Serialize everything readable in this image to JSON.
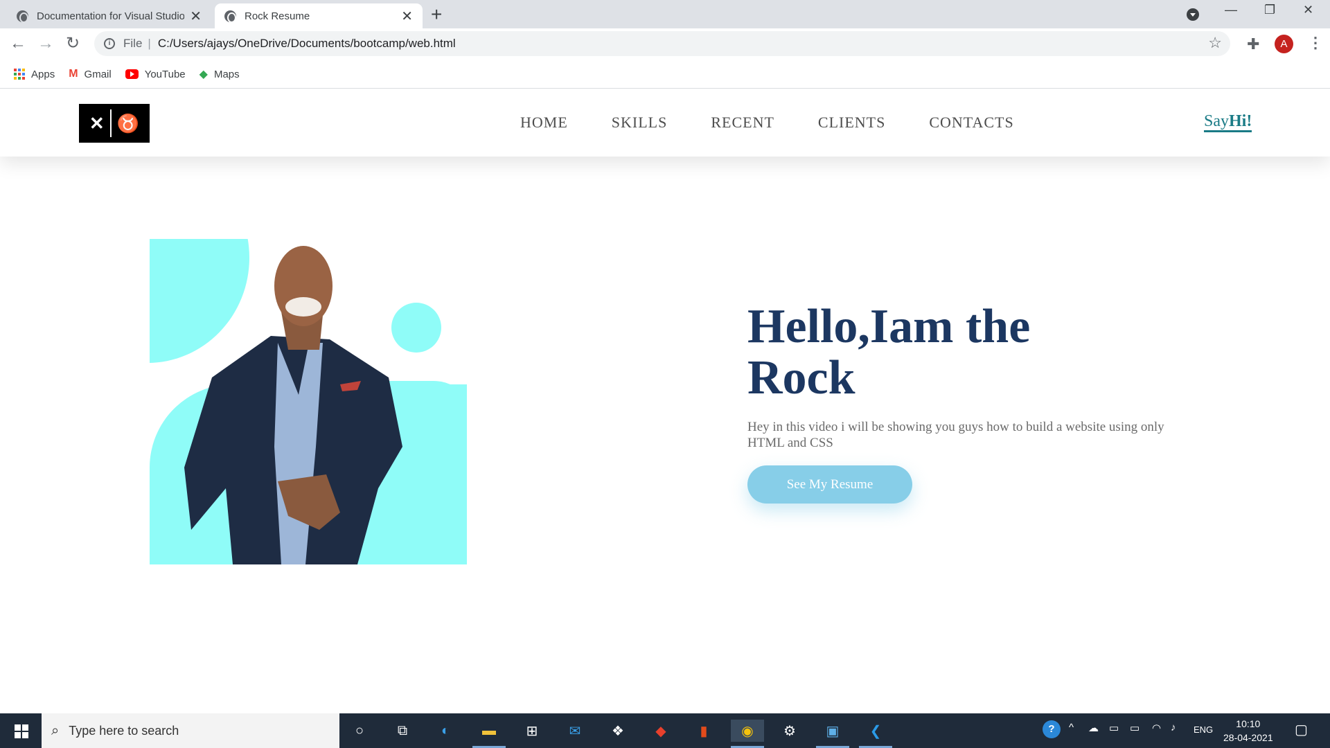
{
  "browser": {
    "tabs": [
      {
        "title": "Documentation for Visual Studio",
        "active": false
      },
      {
        "title": "Rock Resume",
        "active": true
      }
    ],
    "address": {
      "scheme": "File",
      "url": "C:/Users/ajays/OneDrive/Documents/bootcamp/web.html"
    },
    "profile_initial": "A",
    "bookmarks": [
      {
        "label": "Apps",
        "icon": "apps-grid-icon"
      },
      {
        "label": "Gmail",
        "icon": "gmail-icon"
      },
      {
        "label": "YouTube",
        "icon": "youtube-icon"
      },
      {
        "label": "Maps",
        "icon": "maps-icon"
      }
    ]
  },
  "site": {
    "nav": [
      "HOME",
      "SKILLS",
      "RECENT",
      "CLIENTS",
      "CONTACTS"
    ],
    "sayhi": {
      "say": "Say",
      "hi": "Hi!"
    },
    "headline_line1": "Hello,Iam the",
    "headline_line2": "Rock",
    "lede": "Hey in this video i will be showing you guys how to build a website using only HTML and CSS",
    "cta": "See My Resume",
    "colors": {
      "accent": "#8ffcf8",
      "heading": "#1c3761",
      "button": "#87cee8",
      "sayhi": "#1a7b86"
    }
  },
  "taskbar": {
    "search_placeholder": "Type here to search",
    "language": "ENG",
    "time": "10:10",
    "date": "28-04-2021"
  }
}
